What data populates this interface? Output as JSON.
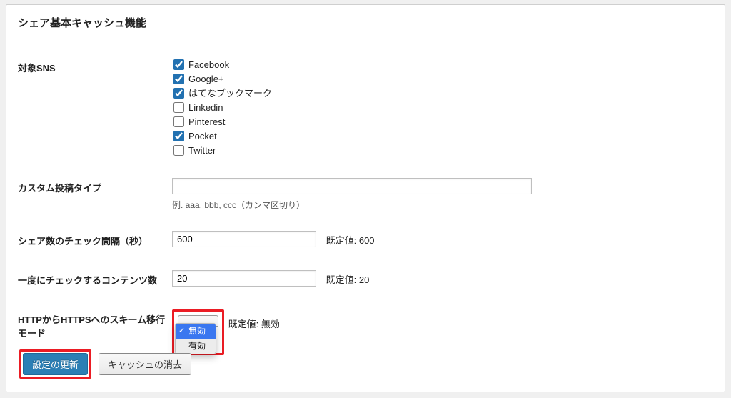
{
  "panel_title": "シェア基本キャッシュ機能",
  "fields": {
    "target_sns_label": "対象SNS",
    "custom_post_type_label": "カスタム投稿タイプ",
    "custom_post_type_help": "例. aaa, bbb, ccc（カンマ区切り）",
    "custom_post_type_value": "",
    "check_interval_label": "シェア数のチェック間隔（秒）",
    "check_interval_value": "600",
    "check_interval_default": "既定値: 600",
    "batch_count_label": "一度にチェックするコンテンツ数",
    "batch_count_value": "20",
    "batch_count_default": "既定値: 20",
    "scheme_mode_label": "HTTPからHTTPSへのスキーム移行モード",
    "scheme_mode_default": "既定値: 無効"
  },
  "sns_options": [
    {
      "label": "Facebook",
      "checked": true
    },
    {
      "label": "Google+",
      "checked": true
    },
    {
      "label": "はてなブックマーク",
      "checked": true
    },
    {
      "label": "Linkedin",
      "checked": false
    },
    {
      "label": "Pinterest",
      "checked": false
    },
    {
      "label": "Pocket",
      "checked": true
    },
    {
      "label": "Twitter",
      "checked": false
    }
  ],
  "scheme_options": [
    {
      "label": "無効",
      "selected": true
    },
    {
      "label": "有効",
      "selected": false
    }
  ],
  "buttons": {
    "update_label": "設定の更新",
    "clear_cache_label": "キャッシュの消去"
  }
}
